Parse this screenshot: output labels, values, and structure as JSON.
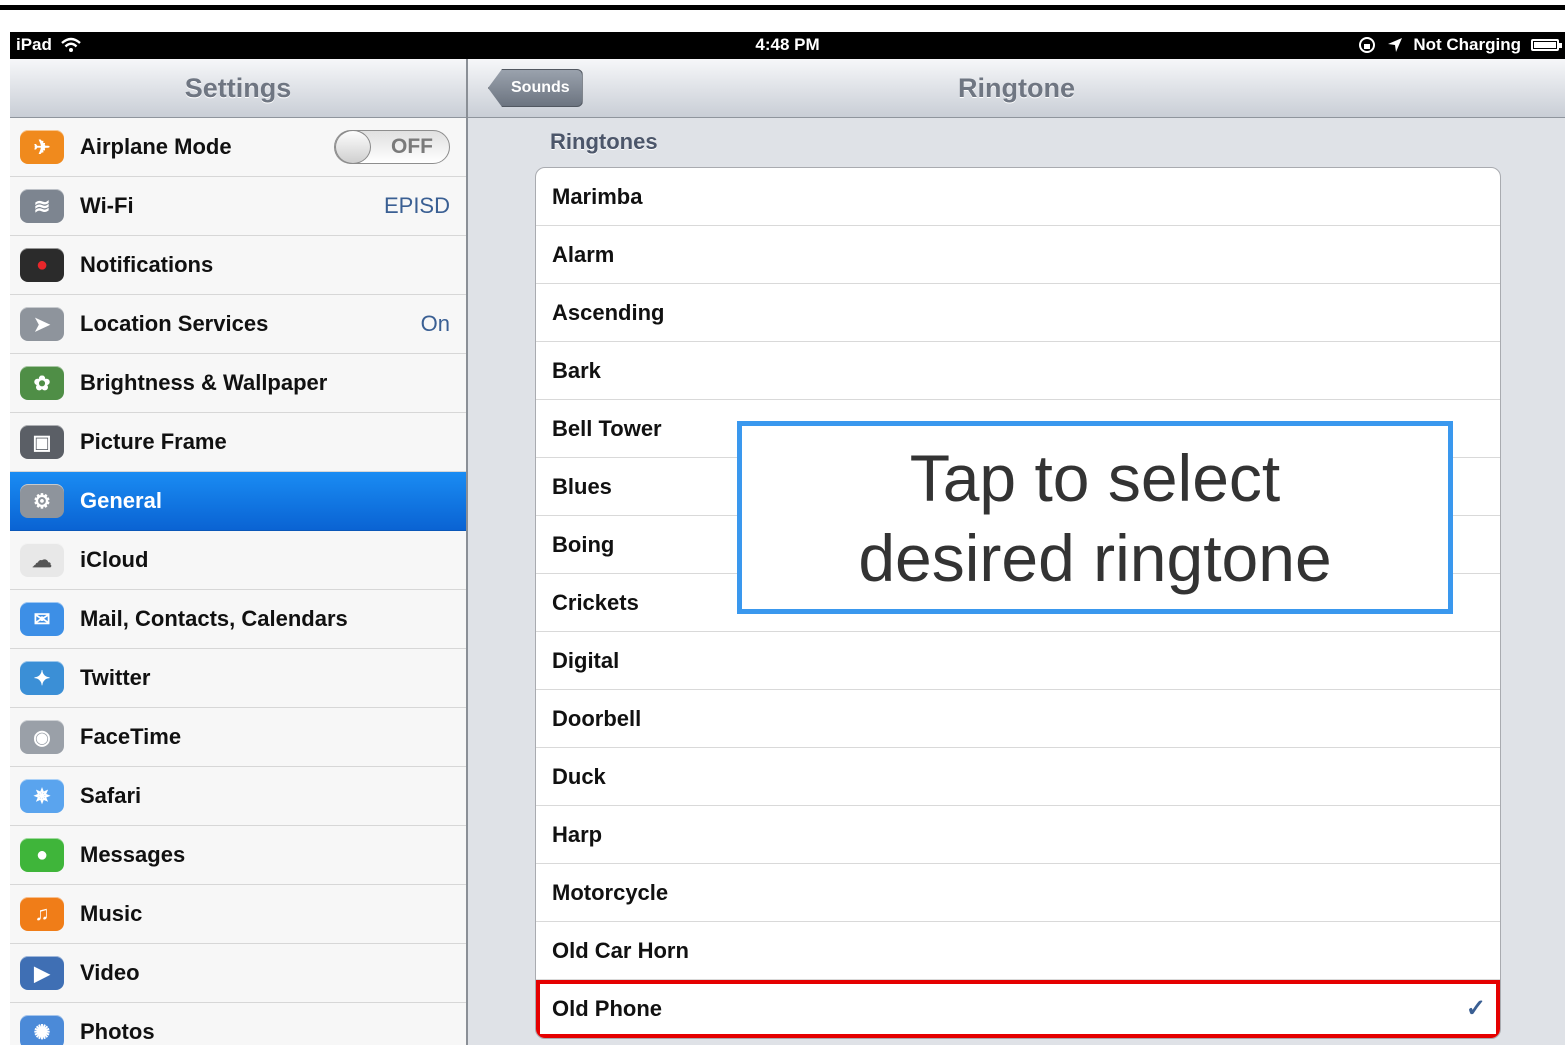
{
  "status_bar": {
    "device": "iPad",
    "time": "4:48 PM",
    "charging": "Not Charging"
  },
  "sidebar": {
    "title": "Settings",
    "items": [
      {
        "label": "Airplane Mode",
        "icon": "airplane-icon",
        "toggle": "OFF",
        "color": "#f08a1d"
      },
      {
        "label": "Wi-Fi",
        "icon": "wifi-icon",
        "value": "EPISD",
        "color": "#7d8590"
      },
      {
        "label": "Notifications",
        "icon": "notifications-icon",
        "color": "#2b2b2b"
      },
      {
        "label": "Location Services",
        "icon": "location-icon",
        "value": "On",
        "color": "#8e949c"
      },
      {
        "label": "Brightness & Wallpaper",
        "icon": "flower-icon",
        "color": "#4f8e46"
      },
      {
        "label": "Picture Frame",
        "icon": "picture-frame-icon",
        "color": "#5b5f66"
      },
      {
        "label": "General",
        "icon": "gear-icon",
        "selected": true,
        "color": "#8e949c"
      },
      {
        "label": "iCloud",
        "icon": "cloud-icon",
        "color": "#e8e8e8"
      },
      {
        "label": "Mail, Contacts, Calendars",
        "icon": "mail-icon",
        "color": "#3d8fe6"
      },
      {
        "label": "Twitter",
        "icon": "twitter-icon",
        "color": "#3b8fd6"
      },
      {
        "label": "FaceTime",
        "icon": "facetime-icon",
        "color": "#9aa0a8"
      },
      {
        "label": "Safari",
        "icon": "safari-icon",
        "color": "#5aa4ee"
      },
      {
        "label": "Messages",
        "icon": "messages-icon",
        "color": "#3fb53a"
      },
      {
        "label": "Music",
        "icon": "music-icon",
        "color": "#f07d18"
      },
      {
        "label": "Video",
        "icon": "video-icon",
        "color": "#3f6fb4"
      },
      {
        "label": "Photos",
        "icon": "photos-icon",
        "color": "#4b8ad8"
      }
    ]
  },
  "detail": {
    "back_button": "Sounds",
    "title": "Ringtone",
    "section_header": "Ringtones",
    "ringtones": [
      {
        "label": "Marimba"
      },
      {
        "label": "Alarm"
      },
      {
        "label": "Ascending"
      },
      {
        "label": "Bark"
      },
      {
        "label": "Bell Tower"
      },
      {
        "label": "Blues"
      },
      {
        "label": "Boing"
      },
      {
        "label": "Crickets"
      },
      {
        "label": "Digital"
      },
      {
        "label": "Doorbell"
      },
      {
        "label": "Duck"
      },
      {
        "label": "Harp"
      },
      {
        "label": "Motorcycle"
      },
      {
        "label": "Old Car Horn"
      },
      {
        "label": "Old Phone",
        "checked": true,
        "check": "✓"
      }
    ]
  },
  "annotation": {
    "line1": "Tap to select",
    "line2": "desired ringtone",
    "border_color": "#3a98ee",
    "highlight_color": "#e50000"
  }
}
